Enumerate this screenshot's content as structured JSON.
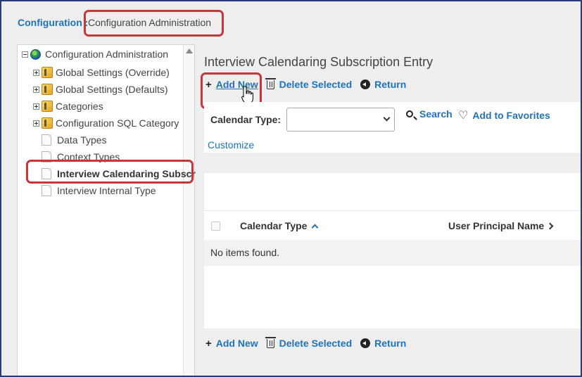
{
  "breadcrumb": {
    "link_label": "Configuration :",
    "current": "Configuration Administration"
  },
  "tree": {
    "root": {
      "label": "Configuration Administration",
      "icon": "globe-icon"
    },
    "items": [
      {
        "label": "Global Settings (Override)",
        "type": "folder",
        "expandable": true
      },
      {
        "label": "Global Settings (Defaults)",
        "type": "folder",
        "expandable": true
      },
      {
        "label": "Categories",
        "type": "folder",
        "expandable": true
      },
      {
        "label": "Configuration SQL Category",
        "type": "folder",
        "expandable": true
      },
      {
        "label": "Data Types",
        "type": "document",
        "expandable": false
      },
      {
        "label": "Context Types",
        "type": "document",
        "expandable": false
      },
      {
        "label": "Interview Calendaring Subscr",
        "type": "document",
        "expandable": false,
        "selected": true
      },
      {
        "label": "Interview Internal Type",
        "type": "document",
        "expandable": false
      }
    ]
  },
  "main": {
    "title": "Interview Calendaring Subscription Entry",
    "toolbar": {
      "add_new": "Add New",
      "delete_selected": "Delete Selected",
      "return": "Return"
    },
    "filter": {
      "calendar_type_label": "Calendar Type:",
      "calendar_type_value": "",
      "search": "Search",
      "add_to_favorites": "Add to Favorites",
      "customize": "Customize"
    },
    "grid": {
      "columns": [
        {
          "label": "Calendar Type",
          "sort": "ascending"
        },
        {
          "label": "User Principal Name",
          "sort": "none"
        }
      ],
      "empty_message": "No items found."
    }
  },
  "colors": {
    "link": "#1e73be",
    "highlight": "#c8363a",
    "frame": "#2b3a78",
    "background": "#eeeeee"
  }
}
